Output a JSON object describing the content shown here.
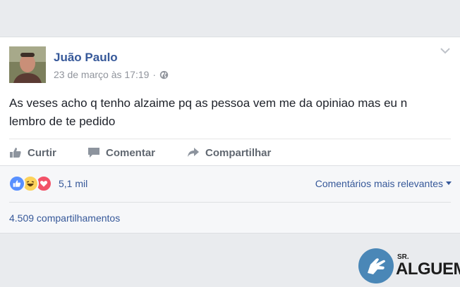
{
  "post": {
    "author": "Juão Paulo",
    "timestamp": "23 de março às 17:19",
    "separator": "·",
    "privacy_icon": "globe-icon",
    "text": "As veses acho q tenho alzaime pq as pessoa vem me da opiniao mas eu n lembro de te pedido"
  },
  "actions": {
    "like": "Curtir",
    "comment": "Comentar",
    "share": "Compartilhar"
  },
  "summary": {
    "reactions": [
      "like-reaction-icon",
      "haha-reaction-icon",
      "love-reaction-icon"
    ],
    "reaction_count": "5,1 mil",
    "sort_label": "Comentários mais relevantes",
    "shares": "4.509 compartilhamentos"
  },
  "watermark": {
    "prefix": "SR.",
    "name": "ALGUEM"
  },
  "colors": {
    "link": "#365899",
    "like": "#5890ff",
    "love": "#f25268",
    "haha": "#fcd25a"
  }
}
